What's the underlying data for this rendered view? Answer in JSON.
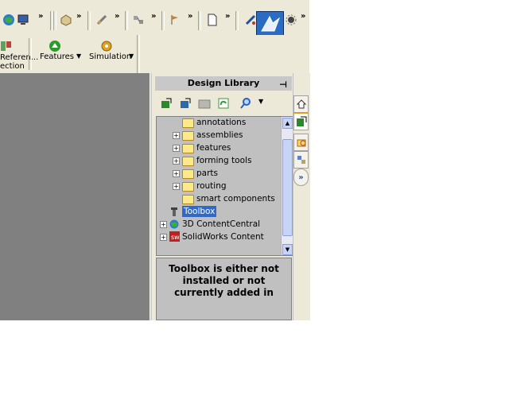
{
  "toolbar": {
    "more": "»",
    "icons": [
      "globe-icon",
      "monitor-icon",
      "part-icon",
      "sketch-icon",
      "assembly-icon",
      "flag-icon",
      "new-document-icon",
      "measure-icon",
      "design-library-icon",
      "sun-icon"
    ]
  },
  "command_manager": {
    "reference": "Referen...",
    "reference_line2": "ection",
    "features": "Features",
    "simulation": "Simulation"
  },
  "panel": {
    "title": "Design Library",
    "pin": "⊣",
    "tree": [
      {
        "label": "annotations",
        "expander": ""
      },
      {
        "label": "assemblies",
        "expander": "+"
      },
      {
        "label": "features",
        "expander": "+"
      },
      {
        "label": "forming tools",
        "expander": "+"
      },
      {
        "label": "parts",
        "expander": "+"
      },
      {
        "label": "routing",
        "expander": "+"
      },
      {
        "label": "smart components",
        "expander": ""
      },
      {
        "label": "Toolbox",
        "expander": ""
      },
      {
        "label": "3D ContentCentral",
        "expander": "+"
      },
      {
        "label": "SolidWorks Content",
        "expander": "+"
      }
    ],
    "message": "Toolbox is either not installed or not currently added in"
  },
  "colors": {
    "accent": "#316ac5",
    "graphics_bg": "#808080",
    "active_tool": "#2a6cc4"
  }
}
